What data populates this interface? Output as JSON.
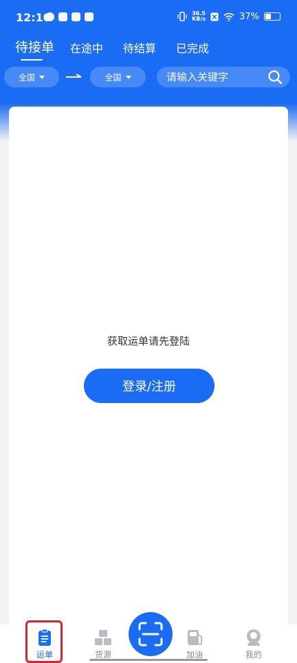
{
  "status_bar": {
    "time": "12:10",
    "net_speed_value": "36.5",
    "net_speed_unit": "KB/s",
    "battery_percent": "37%",
    "battery_level": 0.37
  },
  "tabs": [
    {
      "label": "待接单",
      "active": true
    },
    {
      "label": "在途中",
      "active": false
    },
    {
      "label": "待结算",
      "active": false
    },
    {
      "label": "已完成",
      "active": false
    }
  ],
  "filters": {
    "origin": "全国",
    "destination": "全国"
  },
  "search": {
    "placeholder": "请输入关键字"
  },
  "empty_state": {
    "message": "获取运单请先登陆",
    "button_label": "登录/注册"
  },
  "bottom_nav": [
    {
      "label": "运单",
      "icon": "clipboard-icon",
      "active": true
    },
    {
      "label": "货源",
      "icon": "boxes-icon",
      "active": false
    },
    {
      "label": "",
      "icon": "scan-icon",
      "active": false
    },
    {
      "label": "加油",
      "icon": "fuel-icon",
      "active": false
    },
    {
      "label": "我的",
      "icon": "user-icon",
      "active": false
    }
  ],
  "colors": {
    "primary": "#1a6cf5",
    "highlight": "#e0202a"
  }
}
